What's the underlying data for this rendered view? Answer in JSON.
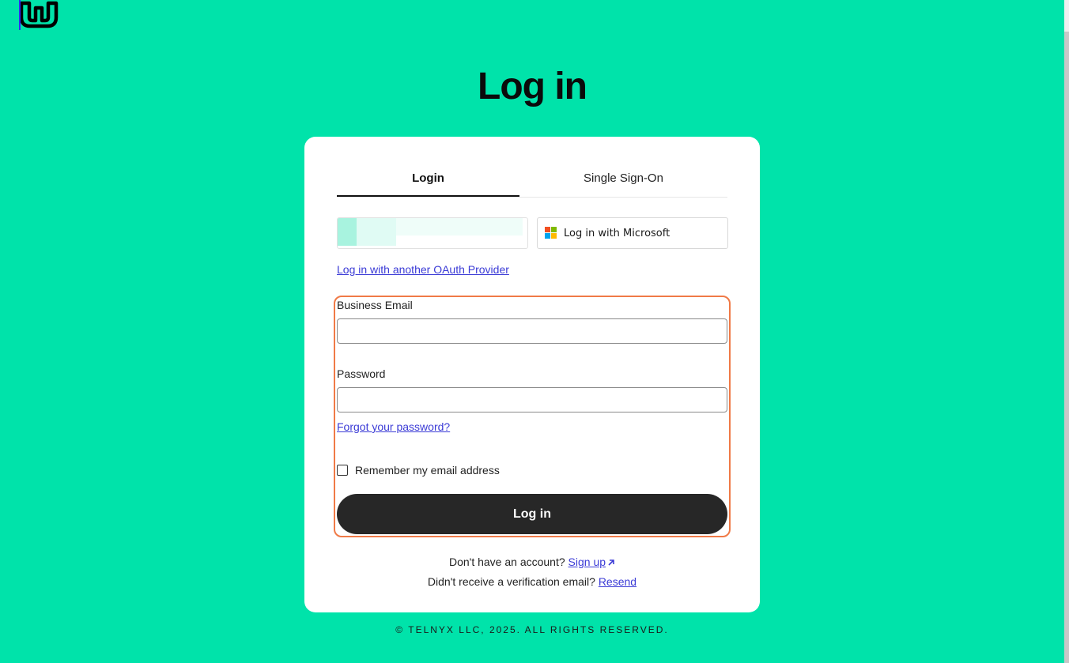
{
  "header": {
    "logo_icon": "telnyx-logo-icon"
  },
  "page": {
    "title": "Log in",
    "background_color": "#00e3aa"
  },
  "tabs": [
    {
      "label": "Login",
      "active": true
    },
    {
      "label": "Single Sign-On",
      "active": false
    }
  ],
  "oauth": {
    "microsoft_label": "Log in with Microsoft",
    "microsoft_icon": "microsoft-logo-icon",
    "other_provider_link": "Log in with another OAuth Provider"
  },
  "form": {
    "email_label": "Business Email",
    "email_value": "",
    "password_label": "Password",
    "password_value": "",
    "forgot_password_link": "Forgot your password?",
    "remember_label": "Remember my email address",
    "remember_checked": false,
    "submit_label": "Log in",
    "highlight_color": "#f07a47"
  },
  "account": {
    "no_account_text": "Don't have an account?",
    "signup_link": "Sign up",
    "signup_icon": "external-arrow-icon",
    "no_verification_text": "Didn't receive a verification email?",
    "resend_link": "Resend"
  },
  "footer": {
    "copyright": "© TELNYX LLC, 2025. ALL RIGHTS RESERVED."
  }
}
